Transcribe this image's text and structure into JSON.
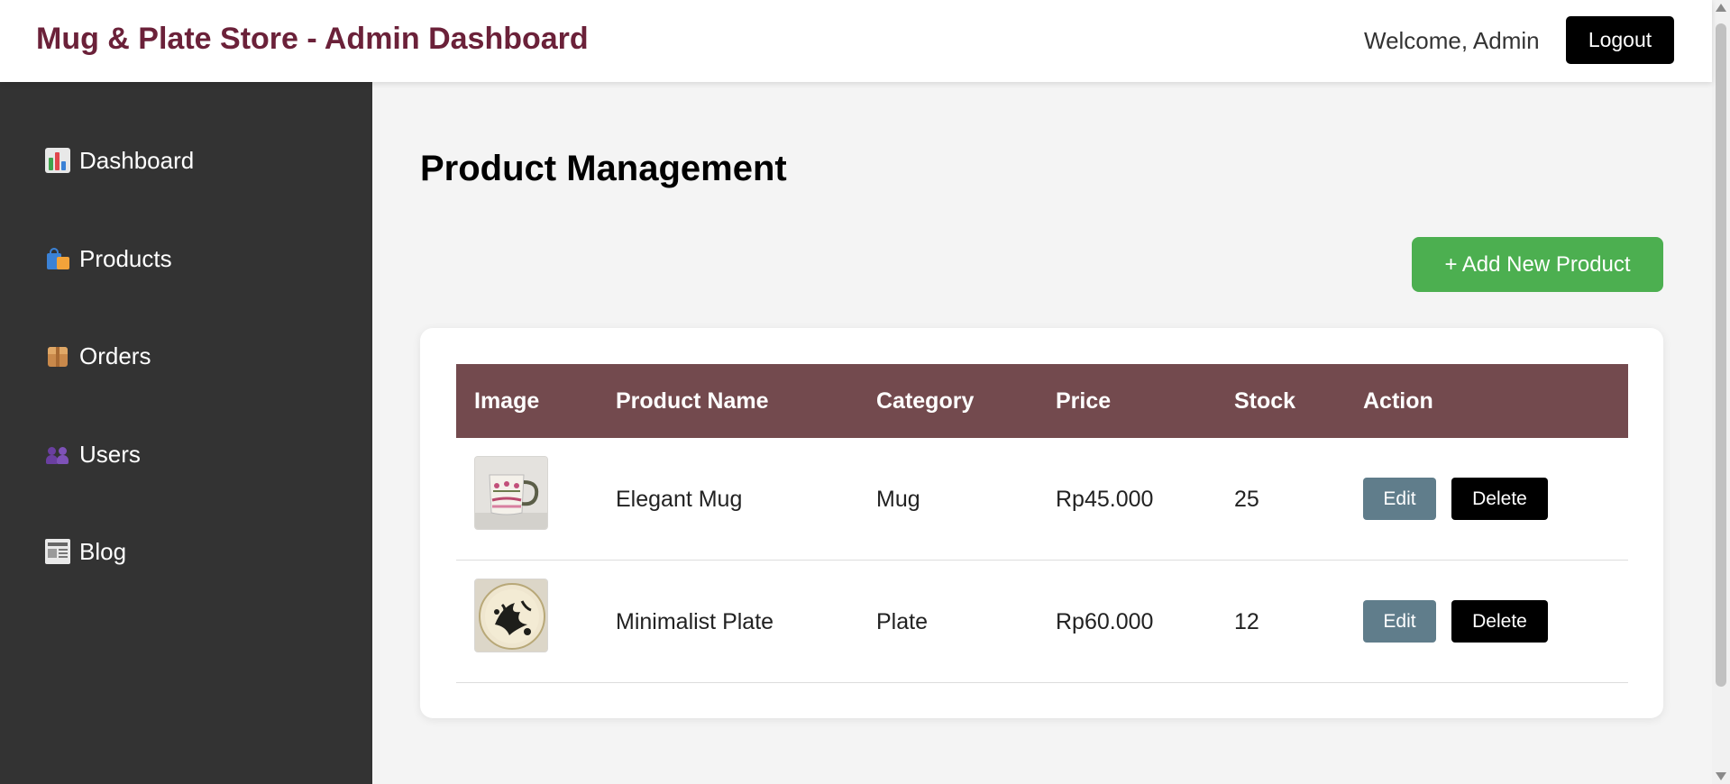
{
  "header": {
    "title": "Mug & Plate Store - Admin Dashboard",
    "welcome": "Welcome, Admin",
    "logout_label": "Logout"
  },
  "sidebar": {
    "items": [
      {
        "label": "Dashboard",
        "icon": "bar-chart-icon"
      },
      {
        "label": "Products",
        "icon": "shopping-bags-icon"
      },
      {
        "label": "Orders",
        "icon": "package-icon"
      },
      {
        "label": "Users",
        "icon": "users-icon"
      },
      {
        "label": "Blog",
        "icon": "newspaper-icon"
      }
    ]
  },
  "main": {
    "title": "Product Management",
    "add_button_label": "+ Add New Product",
    "table": {
      "columns": [
        "Image",
        "Product Name",
        "Category",
        "Price",
        "Stock",
        "Action"
      ],
      "rows": [
        {
          "image": "mug-thumbnail",
          "name": "Elegant Mug",
          "category": "Mug",
          "price": "Rp45.000",
          "stock": "25",
          "edit_label": "Edit",
          "delete_label": "Delete"
        },
        {
          "image": "plate-thumbnail",
          "name": "Minimalist Plate",
          "category": "Plate",
          "price": "Rp60.000",
          "stock": "12",
          "edit_label": "Edit",
          "delete_label": "Delete"
        }
      ]
    }
  },
  "colors": {
    "brand": "#6b2139",
    "sidebar_bg": "#333333",
    "table_header": "#734a4e",
    "add_button": "#4caf50",
    "edit_button": "#607d8b",
    "delete_button": "#000000"
  }
}
